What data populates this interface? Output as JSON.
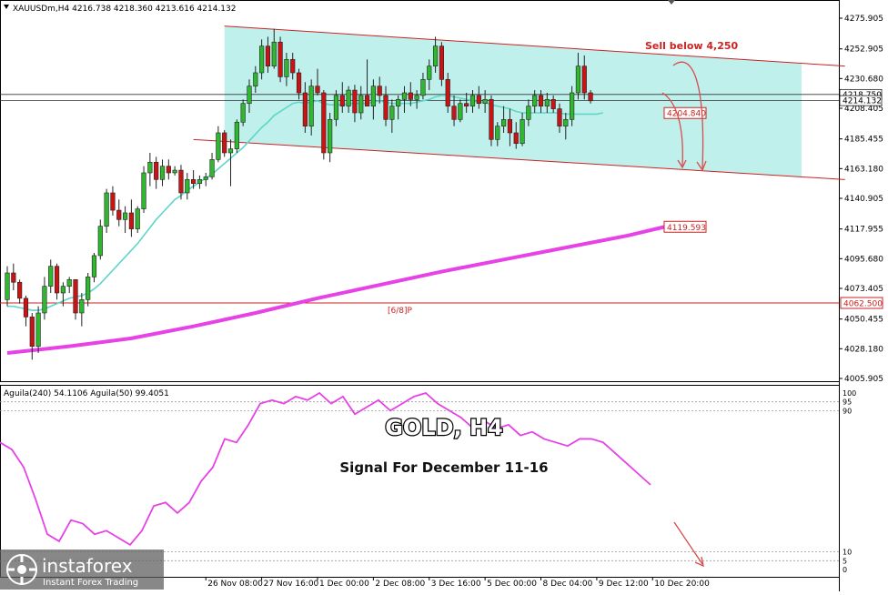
{
  "header": {
    "symbol_line": "XAUUSDm,H4  4216.738 4218.360 4213.616 4214.132"
  },
  "indicator_header": "Aguila(240) 54.1106  Aguila(50) 99.4051",
  "overlay": {
    "title": "GOLD, H4",
    "subtitle": "Signal For December 11-16",
    "sell_note": "Sell below 4,250",
    "pivot_label": "[6/8]P"
  },
  "watermark": {
    "brand": "instaforex",
    "tagline": "Instant Forex Trading"
  },
  "colors": {
    "bull": "#2fb82f",
    "bear": "#c81414",
    "channel_fill": "#bff0ec",
    "channel_line": "#cc2222",
    "ma_fast": "#5ed6c8",
    "ma_slow": "#e642e6",
    "oscillator": "#e642e6",
    "arrow": "#d94a4a"
  },
  "chart_data": [
    {
      "type": "candlestick",
      "symbol": "XAUUSDm",
      "timeframe": "H4",
      "ylim": [
        4005.905,
        4275.905
      ],
      "y_ticks": [
        "4275.905",
        "4252.905",
        "4230.680",
        "4208.405",
        "4185.455",
        "4163.180",
        "4140.905",
        "4117.955",
        "4095.680",
        "4073.405",
        "4050.455",
        "4028.180",
        "4005.905"
      ],
      "x_ticks": [
        {
          "label": "26 Nov 08:00",
          "i": 32
        },
        {
          "label": "27 Nov 16:00",
          "i": 41
        },
        {
          "label": "1 Dec 00:00",
          "i": 50
        },
        {
          "label": "2 Dec 08:00",
          "i": 59
        },
        {
          "label": "3 Dec 16:00",
          "i": 68
        },
        {
          "label": "5 Dec 00:00",
          "i": 77
        },
        {
          "label": "8 Dec 04:00",
          "i": 86
        },
        {
          "label": "9 Dec 12:00",
          "i": 95
        },
        {
          "label": "10 Dec 20:00",
          "i": 104
        }
      ],
      "price_labels": [
        {
          "value": 4218.75,
          "text": "4218.750",
          "kind": "bid"
        },
        {
          "value": 4214.132,
          "text": "4214.132",
          "kind": "last"
        },
        {
          "value": 4204.84,
          "text": "4204.840",
          "kind": "ma_fast"
        },
        {
          "value": 4119.593,
          "text": "4119.593",
          "kind": "ma_slow"
        },
        {
          "value": 4062.5,
          "text": "4062.500",
          "kind": "pivot"
        }
      ],
      "horizontal_lines": [
        4218.75,
        4214.132,
        4062.5
      ],
      "channel": {
        "upper": [
          [
            35,
            4270.0
          ],
          [
            135,
            4240.0
          ]
        ],
        "lower": [
          [
            30,
            4185.0
          ],
          [
            135,
            4155.0
          ]
        ]
      },
      "candles": [
        [
          4065,
          4090,
          4060,
          4085
        ],
        [
          4085,
          4092,
          4072,
          4078
        ],
        [
          4078,
          4080,
          4062,
          4066
        ],
        [
          4066,
          4068,
          4045,
          4052
        ],
        [
          4052,
          4055,
          4020,
          4030
        ],
        [
          4030,
          4060,
          4025,
          4055
        ],
        [
          4055,
          4082,
          4050,
          4075
        ],
        [
          4075,
          4095,
          4070,
          4090
        ],
        [
          4090,
          4092,
          4065,
          4070
        ],
        [
          4070,
          4078,
          4060,
          4075
        ],
        [
          4075,
          4082,
          4070,
          4080
        ],
        [
          4080,
          4075,
          4050,
          4055
        ],
        [
          4055,
          4070,
          4045,
          4065
        ],
        [
          4065,
          4085,
          4060,
          4082
        ],
        [
          4082,
          4100,
          4078,
          4098
        ],
        [
          4098,
          4125,
          4095,
          4120
        ],
        [
          4120,
          4148,
          4115,
          4145
        ],
        [
          4145,
          4150,
          4128,
          4132
        ],
        [
          4132,
          4140,
          4120,
          4125
        ],
        [
          4125,
          4135,
          4115,
          4130
        ],
        [
          4130,
          4140,
          4112,
          4118
        ],
        [
          4118,
          4135,
          4115,
          4133
        ],
        [
          4133,
          4165,
          4130,
          4160
        ],
        [
          4160,
          4175,
          4150,
          4168
        ],
        [
          4168,
          4172,
          4148,
          4155
        ],
        [
          4155,
          4170,
          4150,
          4165
        ],
        [
          4165,
          4170,
          4155,
          4160
        ],
        [
          4160,
          4165,
          4158,
          4162
        ],
        [
          4162,
          4166,
          4140,
          4145
        ],
        [
          4145,
          4160,
          4140,
          4155
        ],
        [
          4155,
          4162,
          4148,
          4152
        ],
        [
          4152,
          4158,
          4148,
          4155
        ],
        [
          4155,
          4160,
          4150,
          4157
        ],
        [
          4157,
          4175,
          4155,
          4170
        ],
        [
          4170,
          4195,
          4168,
          4190
        ],
        [
          4190,
          4192,
          4172,
          4175
        ],
        [
          4175,
          4185,
          4150,
          4178
        ],
        [
          4178,
          4200,
          4175,
          4198
        ],
        [
          4198,
          4215,
          4195,
          4212
        ],
        [
          4212,
          4230,
          4205,
          4225
        ],
        [
          4225,
          4240,
          4220,
          4235
        ],
        [
          4235,
          4260,
          4230,
          4255
        ],
        [
          4255,
          4262,
          4235,
          4240
        ],
        [
          4240,
          4268,
          4238,
          4258
        ],
        [
          4258,
          4262,
          4228,
          4232
        ],
        [
          4232,
          4250,
          4225,
          4245
        ],
        [
          4245,
          4250,
          4230,
          4235
        ],
        [
          4235,
          4238,
          4215,
          4220
        ],
        [
          4220,
          4228,
          4190,
          4195
        ],
        [
          4195,
          4230,
          4188,
          4225
        ],
        [
          4225,
          4238,
          4218,
          4220
        ],
        [
          4220,
          4222,
          4170,
          4175
        ],
        [
          4175,
          4205,
          4168,
          4200
        ],
        [
          4200,
          4222,
          4195,
          4218
        ],
        [
          4218,
          4228,
          4205,
          4210
        ],
        [
          4210,
          4225,
          4205,
          4222
        ],
        [
          4222,
          4226,
          4198,
          4205
        ],
        [
          4205,
          4225,
          4200,
          4218
        ],
        [
          4218,
          4245,
          4212,
          4210
        ],
        [
          4210,
          4230,
          4200,
          4225
        ],
        [
          4225,
          4232,
          4212,
          4218
        ],
        [
          4218,
          4225,
          4195,
          4200
        ],
        [
          4200,
          4215,
          4190,
          4210
        ],
        [
          4210,
          4218,
          4200,
          4215
        ],
        [
          4215,
          4225,
          4205,
          4220
        ],
        [
          4220,
          4228,
          4210,
          4215
        ],
        [
          4215,
          4222,
          4208,
          4218
        ],
        [
          4218,
          4235,
          4215,
          4230
        ],
        [
          4230,
          4245,
          4222,
          4240
        ],
        [
          4240,
          4262,
          4235,
          4255
        ],
        [
          4255,
          4258,
          4225,
          4230
        ],
        [
          4230,
          4235,
          4205,
          4210
        ],
        [
          4210,
          4218,
          4195,
          4200
        ],
        [
          4200,
          4215,
          4198,
          4212
        ],
        [
          4212,
          4220,
          4205,
          4210
        ],
        [
          4210,
          4222,
          4205,
          4218
        ],
        [
          4218,
          4225,
          4208,
          4212
        ],
        [
          4212,
          4222,
          4205,
          4215
        ],
        [
          4215,
          4218,
          4180,
          4185
        ],
        [
          4185,
          4198,
          4180,
          4195
        ],
        [
          4195,
          4210,
          4190,
          4200
        ],
        [
          4200,
          4208,
          4180,
          4190
        ],
        [
          4190,
          4198,
          4178,
          4182
        ],
        [
          4182,
          4205,
          4180,
          4200
        ],
        [
          4200,
          4215,
          4195,
          4210
        ],
        [
          4210,
          4222,
          4205,
          4218
        ],
        [
          4218,
          4222,
          4205,
          4210
        ],
        [
          4210,
          4220,
          4205,
          4215
        ],
        [
          4215,
          4218,
          4205,
          4208
        ],
        [
          4208,
          4212,
          4190,
          4195
        ],
        [
          4195,
          4205,
          4185,
          4200
        ],
        [
          4200,
          4225,
          4195,
          4220
        ],
        [
          4220,
          4250,
          4215,
          4240
        ],
        [
          4240,
          4248,
          4215,
          4220
        ],
        [
          4220,
          4222,
          4212,
          4214
        ]
      ],
      "ma_fast": [
        4060,
        4060,
        4059,
        4058,
        4057,
        4057,
        4058,
        4060,
        4062,
        4064,
        4066,
        4067,
        4068,
        4070,
        4073,
        4077,
        4082,
        4087,
        4092,
        4097,
        4102,
        4107,
        4113,
        4119,
        4125,
        4130,
        4135,
        4140,
        4143,
        4147,
        4150,
        4153,
        4156,
        4159,
        4163,
        4167,
        4171,
        4175,
        4179,
        4184,
        4189,
        4194,
        4198,
        4203,
        4206,
        4209,
        4212,
        4213,
        4212,
        4213,
        4214,
        4212,
        4211,
        4211,
        4211,
        4212,
        4212,
        4212,
        4212,
        4213,
        4214,
        4213,
        4212,
        4212,
        4212,
        4212,
        4213,
        4214,
        4215,
        4217,
        4218,
        4218,
        4217,
        4216,
        4215,
        4214,
        4213,
        4213,
        4211,
        4210,
        4209,
        4208,
        4206,
        4205,
        4205,
        4205,
        4205,
        4205,
        4205,
        4205,
        4204,
        4204,
        4204,
        4204,
        4204,
        4204,
        4205
      ],
      "ma_slow": [
        [
          0,
          4025
        ],
        [
          10,
          4030
        ],
        [
          20,
          4036
        ],
        [
          30,
          4045
        ],
        [
          40,
          4055
        ],
        [
          50,
          4066
        ],
        [
          60,
          4076
        ],
        [
          70,
          4086
        ],
        [
          80,
          4095
        ],
        [
          90,
          4104
        ],
        [
          100,
          4113
        ],
        [
          106,
          4119.593
        ]
      ]
    },
    {
      "type": "line",
      "name": "Aguila(240)",
      "ylim": [
        0,
        100
      ],
      "levels": [
        0,
        5,
        10,
        90,
        95,
        100
      ],
      "x_step": 6,
      "values": [
        72,
        68,
        58,
        40,
        20,
        16,
        28,
        26,
        20,
        22,
        18,
        14,
        22,
        36,
        38,
        32,
        38,
        50,
        58,
        74,
        72,
        82,
        94,
        96,
        94,
        98,
        96,
        100,
        94,
        98,
        88,
        92,
        96,
        90,
        94,
        98,
        100,
        94,
        90,
        86,
        80,
        84,
        80,
        82,
        76,
        78,
        74,
        72,
        70,
        74,
        74,
        72,
        66,
        60,
        54,
        48
      ]
    }
  ]
}
